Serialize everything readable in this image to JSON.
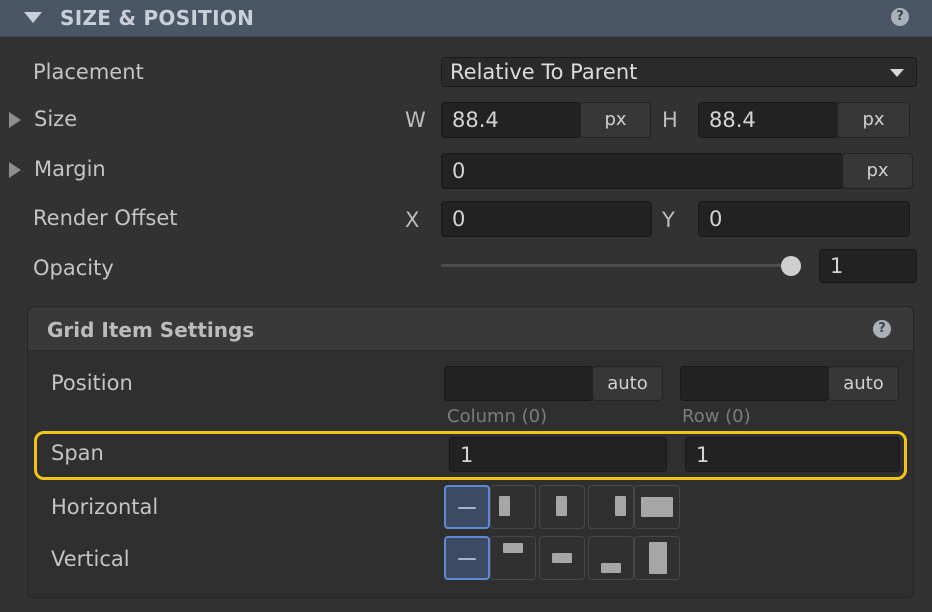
{
  "section": {
    "title": "SIZE & POSITION",
    "help_icon": "?"
  },
  "placement": {
    "label": "Placement",
    "value": "Relative To Parent"
  },
  "size": {
    "label": "Size",
    "w_label": "W",
    "w_value": "88.4",
    "w_unit": "px",
    "h_label": "H",
    "h_value": "88.4",
    "h_unit": "px"
  },
  "margin": {
    "label": "Margin",
    "value": "0",
    "unit": "px"
  },
  "render_offset": {
    "label": "Render Offset",
    "x_label": "X",
    "x_value": "0",
    "y_label": "Y",
    "y_value": "0"
  },
  "opacity": {
    "label": "Opacity",
    "value": "1",
    "slider_level": 1.0
  },
  "grid_item": {
    "title": "Grid Item Settings",
    "help_icon": "?",
    "position": {
      "label": "Position",
      "column_value": "",
      "column_unit": "auto",
      "row_value": "",
      "row_unit": "auto",
      "column_caption": "Column (0)",
      "row_caption": "Row (0)"
    },
    "span": {
      "label": "Span",
      "column_value": "1",
      "row_value": "1"
    },
    "horizontal": {
      "label": "Horizontal",
      "options": [
        "auto-icon",
        "align-start-icon",
        "align-center-icon",
        "align-end-icon",
        "stretch-icon"
      ],
      "selected": "auto-icon"
    },
    "vertical": {
      "label": "Vertical",
      "options": [
        "auto-icon",
        "align-top-icon",
        "align-middle-icon",
        "align-bottom-icon",
        "stretch-icon"
      ],
      "selected": "auto-icon"
    }
  },
  "colors": {
    "highlight": "#f1c419",
    "active_button": "#5d8ad6",
    "header": "#4a5565"
  }
}
